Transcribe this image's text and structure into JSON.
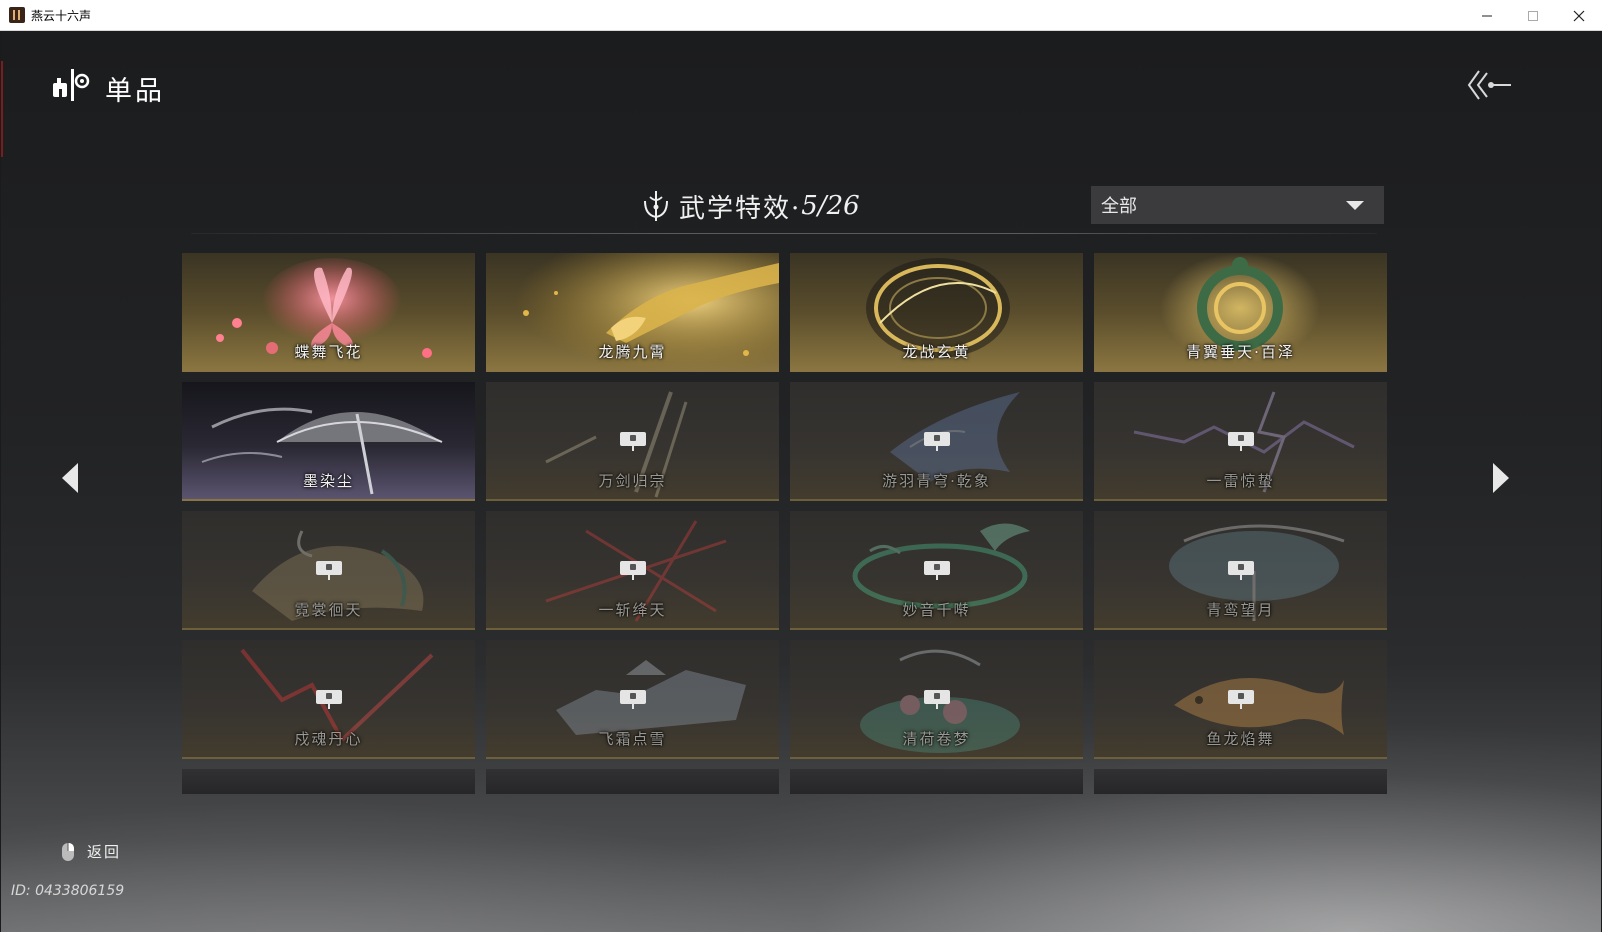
{
  "window": {
    "title": "燕云十六声"
  },
  "header": {
    "title": "单品"
  },
  "section": {
    "title": "武学特效·",
    "count": "5/26"
  },
  "filter": {
    "selected": "全部"
  },
  "cards": [
    {
      "name": "蝶舞飞花",
      "locked": false,
      "theme": "gold"
    },
    {
      "name": "龙腾九霄",
      "locked": false,
      "theme": "gold"
    },
    {
      "name": "龙战玄黄",
      "locked": false,
      "theme": "gold"
    },
    {
      "name": "青翼垂天·百泽",
      "locked": false,
      "theme": "gold"
    },
    {
      "name": "墨染尘",
      "locked": false,
      "theme": "purple"
    },
    {
      "name": "万剑归宗",
      "locked": true
    },
    {
      "name": "游羽青穹·乾象",
      "locked": true
    },
    {
      "name": "一雷惊蛰",
      "locked": true
    },
    {
      "name": "霓裳徊天",
      "locked": true
    },
    {
      "name": "一斩绛天",
      "locked": true
    },
    {
      "name": "妙音千啭",
      "locked": true
    },
    {
      "name": "青鸾望月",
      "locked": true
    },
    {
      "name": "戍魂丹心",
      "locked": true
    },
    {
      "name": "飞霜点雪",
      "locked": true
    },
    {
      "name": "清荷卷梦",
      "locked": true
    },
    {
      "name": "鱼龙焰舞",
      "locked": true
    }
  ],
  "footer": {
    "back_label": "返回",
    "uid": "ID: 0433806159"
  },
  "colors": {
    "accent_gold": "#8a7446",
    "text": "#f0f0f0"
  }
}
